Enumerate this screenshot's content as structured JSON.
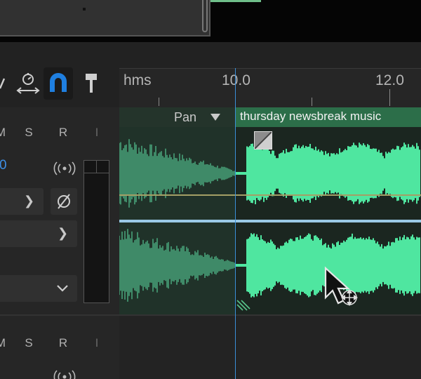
{
  "toolbar": {
    "tools": [
      {
        "icon": "time-selection-icon"
      },
      {
        "icon": "stopwatch-move-icon"
      },
      {
        "icon": "magnet-snap-icon",
        "active": true,
        "active_color": "#1f7fe0"
      },
      {
        "icon": "pin-marker-icon"
      }
    ]
  },
  "ruler": {
    "unit_label": "hms",
    "ticks": [
      "10.0",
      "12.0"
    ]
  },
  "track": {
    "buttons": [
      "M",
      "S",
      "R",
      "I"
    ],
    "volume_value": "0",
    "mono_input_icon": "radio-waves-icon",
    "phase_invert_icon": "phase-invert-icon",
    "clip_title": "thursday newsbreak music",
    "lane_label": "Pan",
    "colors": {
      "clip_header": "#2c6e49",
      "waveform": "#4fe6a0",
      "waveform_dim": "#3f8a68",
      "playhead": "#3b8fd8",
      "pan_line": "#a39f66"
    }
  },
  "track2": {
    "buttons": [
      "M",
      "S",
      "R",
      "I"
    ],
    "mono_input_icon": "radio-waves-icon"
  },
  "cursor": {
    "icon": "move-arrow-cursor-icon"
  }
}
